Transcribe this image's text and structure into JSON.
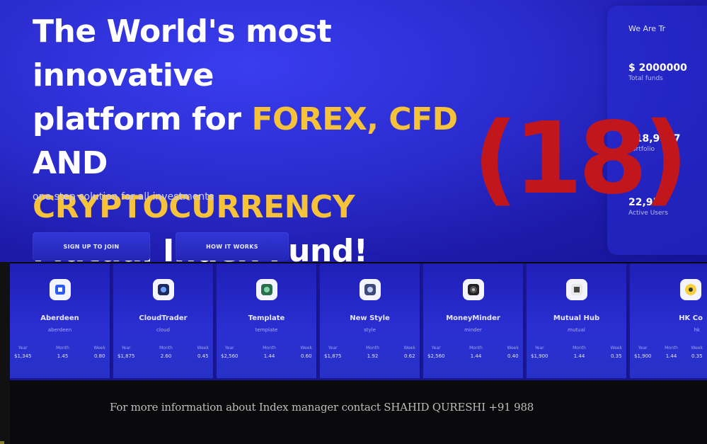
{
  "hero": {
    "headline_line1": "The World's most innovative",
    "headline_line2_prefix": "platform for ",
    "headline_line2_highlight": "FOREX, CFD",
    "headline_line2_suffix": " AND",
    "headline_line3": "CRYPTOCURRENCY",
    "headline_line4": "Mutual Index Fund!",
    "tagline": "one step solution for all investments",
    "buttons": [
      {
        "label": "SIGN UP TO JOIN"
      },
      {
        "label": "HOW IT WORKS"
      }
    ]
  },
  "stats_panel": {
    "title": "We Are Tr",
    "items": [
      {
        "value": "$ 2000000",
        "label": "Total funds"
      },
      {
        "value": "$18,9807",
        "label": "Portfolio"
      },
      {
        "value": "22,957",
        "label": "Active Users"
      }
    ]
  },
  "overlay_number": "(18)",
  "fund_cards": [
    {
      "name": "Aberdeen",
      "sub": "aberdeen",
      "icon": "square-blue-icon",
      "metrics": [
        {
          "k": "Year",
          "v": "$1,345"
        },
        {
          "k": "Month",
          "v": "1.45"
        },
        {
          "k": "Week",
          "v": "0.80"
        }
      ]
    },
    {
      "name": "CloudTrader",
      "sub": "cloud",
      "icon": "cloud-icon",
      "metrics": [
        {
          "k": "Year",
          "v": "$1,875"
        },
        {
          "k": "Month",
          "v": "2.60"
        },
        {
          "k": "Week",
          "v": "0.45"
        }
      ]
    },
    {
      "name": "Template",
      "sub": "template",
      "icon": "leaf-icon",
      "metrics": [
        {
          "k": "Year",
          "v": "$2,560"
        },
        {
          "k": "Month",
          "v": "1.44"
        },
        {
          "k": "Week",
          "v": "0.60"
        }
      ]
    },
    {
      "name": "New Style",
      "sub": "style",
      "icon": "gear-icon",
      "metrics": [
        {
          "k": "Year",
          "v": "$1,875"
        },
        {
          "k": "Month",
          "v": "1.92"
        },
        {
          "k": "Week",
          "v": "0.62"
        }
      ]
    },
    {
      "name": "MoneyMinder",
      "sub": "minder",
      "icon": "target-icon",
      "metrics": [
        {
          "k": "Year",
          "v": "$2,560"
        },
        {
          "k": "Month",
          "v": "1.44"
        },
        {
          "k": "Week",
          "v": "0.40"
        }
      ]
    },
    {
      "name": "Mutual Hub",
      "sub": "mutual",
      "icon": "grid-icon",
      "metrics": [
        {
          "k": "Year",
          "v": "$1,900"
        },
        {
          "k": "Month",
          "v": "1.44"
        },
        {
          "k": "Week",
          "v": "0.35"
        }
      ]
    },
    {
      "name": "HK Co",
      "sub": "hk",
      "icon": "coin-icon",
      "metrics": [
        {
          "k": "Year",
          "v": "$1,900"
        },
        {
          "k": "Month",
          "v": "1.44"
        },
        {
          "k": "Week",
          "v": "0.35"
        }
      ]
    }
  ],
  "footer": {
    "text": "For more information about Index manager contact SHAHID QURESHI +91 988"
  },
  "colors": {
    "hero_blue": "#2a2bcc",
    "highlight_yellow": "#f6c23a",
    "overlay_red": "#c2161d"
  }
}
